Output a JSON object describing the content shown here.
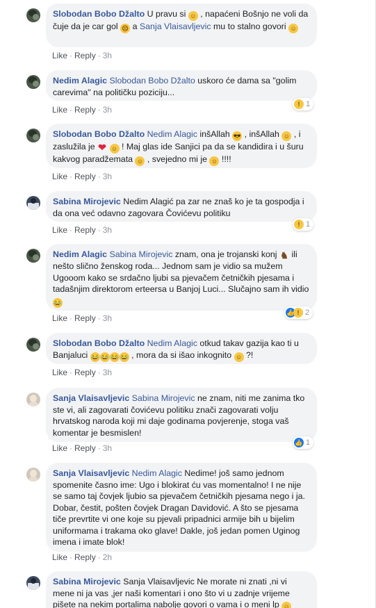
{
  "comments": [
    {
      "author": "Slobodan Bobo Džalto",
      "parts": [
        "U pravu si ",
        " , napaćeni Bošnjo ne voli da čuje da je car gol ",
        " a ",
        " mu to stalno govori "
      ],
      "mentions": [
        "Sanja Vlaisavljevic"
      ],
      "like": "Like",
      "reply": "Reply",
      "time": "3h"
    },
    {
      "author": "Nedim Alagic",
      "mention": "Slobodan Bobo Džalto",
      "text": " uskoro će dama sa \"golim carevima\" na političku poziciju...",
      "like": "Like",
      "reply": "Reply",
      "time": "3h",
      "reaction_count": "1"
    },
    {
      "author": "Slobodan Bobo Džalto",
      "mention": "Nedim Alagic",
      "parts": [
        " inšAllah ",
        " , inšAllah ",
        " , i zaslužila je ",
        " ",
        " ! Maj glas ide Sanjici pa da se kandidira i u šuru kakvog paradžemata ",
        " , svejedno mi je ",
        " !!!!"
      ],
      "like": "Like",
      "reply": "Reply",
      "time": "3h"
    },
    {
      "author": "Sabina Mirojevic",
      "text": "Nedim Alagić pa zar ne znaš ko je ta gospodja i da ona već odavno zagovara Čovićevu politiku",
      "like": "Like",
      "reply": "Reply",
      "time": "3h",
      "reaction_count": "1"
    },
    {
      "author": "Nedim Alagic",
      "mention": "Sabina Mirojevic",
      "text": " znam, ona je trojanski konj ",
      "text2": " ili nešto slično ženskog roda... Jednom sam je vidio sa mužem Ugooom kako se srdačno ljubi sa pjevačem četničkih pjesama i tadašnjim direktorom erteersa u Banjoj Luci... Slučajno sam ih vidio ",
      "like": "Like",
      "reply": "Reply",
      "time": "3h",
      "reaction_count": "2"
    },
    {
      "author": "Slobodan Bobo Džalto",
      "mention": "Nedim Alagic",
      "parts": [
        " otkud takav gazija kao ti u Banjaluci ",
        " , mora da si išao inkognito ",
        " ?!"
      ],
      "like": "Like",
      "reply": "Reply",
      "time": "3h"
    },
    {
      "author": "Sanja Vlaisavljevic",
      "mention": "Sabina Mirojevic",
      "text": " ne znam, niti me zanima tko ste vi, ali zagovarati čovićevu politiku znači zagovarati volju hrvatskog naroda koji mi daje godinama povjerenje, stoga vaš komentar je besmislen!",
      "like": "Like",
      "reply": "Reply",
      "time": "3h",
      "reaction_count": "1"
    },
    {
      "author": "Sanja Vlaisavljevic",
      "mention": "Nedim Alagic",
      "text": " Nedime! još samo jednom spomenite časno ime: Ugo i blokirat ću vas momentalno! I ne nije se samo taj čovjek ljubio sa pjevačem četničkih pjesama nego i ja. Dobar, čestit, pošten čovjek Dragan Davidović. A što se pjesama tiče prevrtite vi one koje su pjevali pripadnici armije bih u bijelim uniformama i trakama oko glave! Dakle, još jedan pomen Uginog imena i imate blok!",
      "like": "Like",
      "reply": "Reply",
      "time": "2h"
    },
    {
      "author": "Sabina Mirojevic",
      "text": "Sanja Vlaisavljevic Ne morate ni znati ,ni vi mene ni ja vas ,jer naši komentari i ono što vi u zadnje vrijeme pišete na nekim portalima nabolje govori o vama i o meni lp "
    }
  ],
  "emoji": {
    "smile": "☺",
    "sad": "☹",
    "cool": "😎",
    "heart": "❤",
    "horse": "♞",
    "rofl": "😂",
    "wow": "!",
    "like": "👍"
  },
  "colors": {
    "link": "#385898",
    "bubble": "#f2f3f5",
    "meta": "#90949c"
  }
}
